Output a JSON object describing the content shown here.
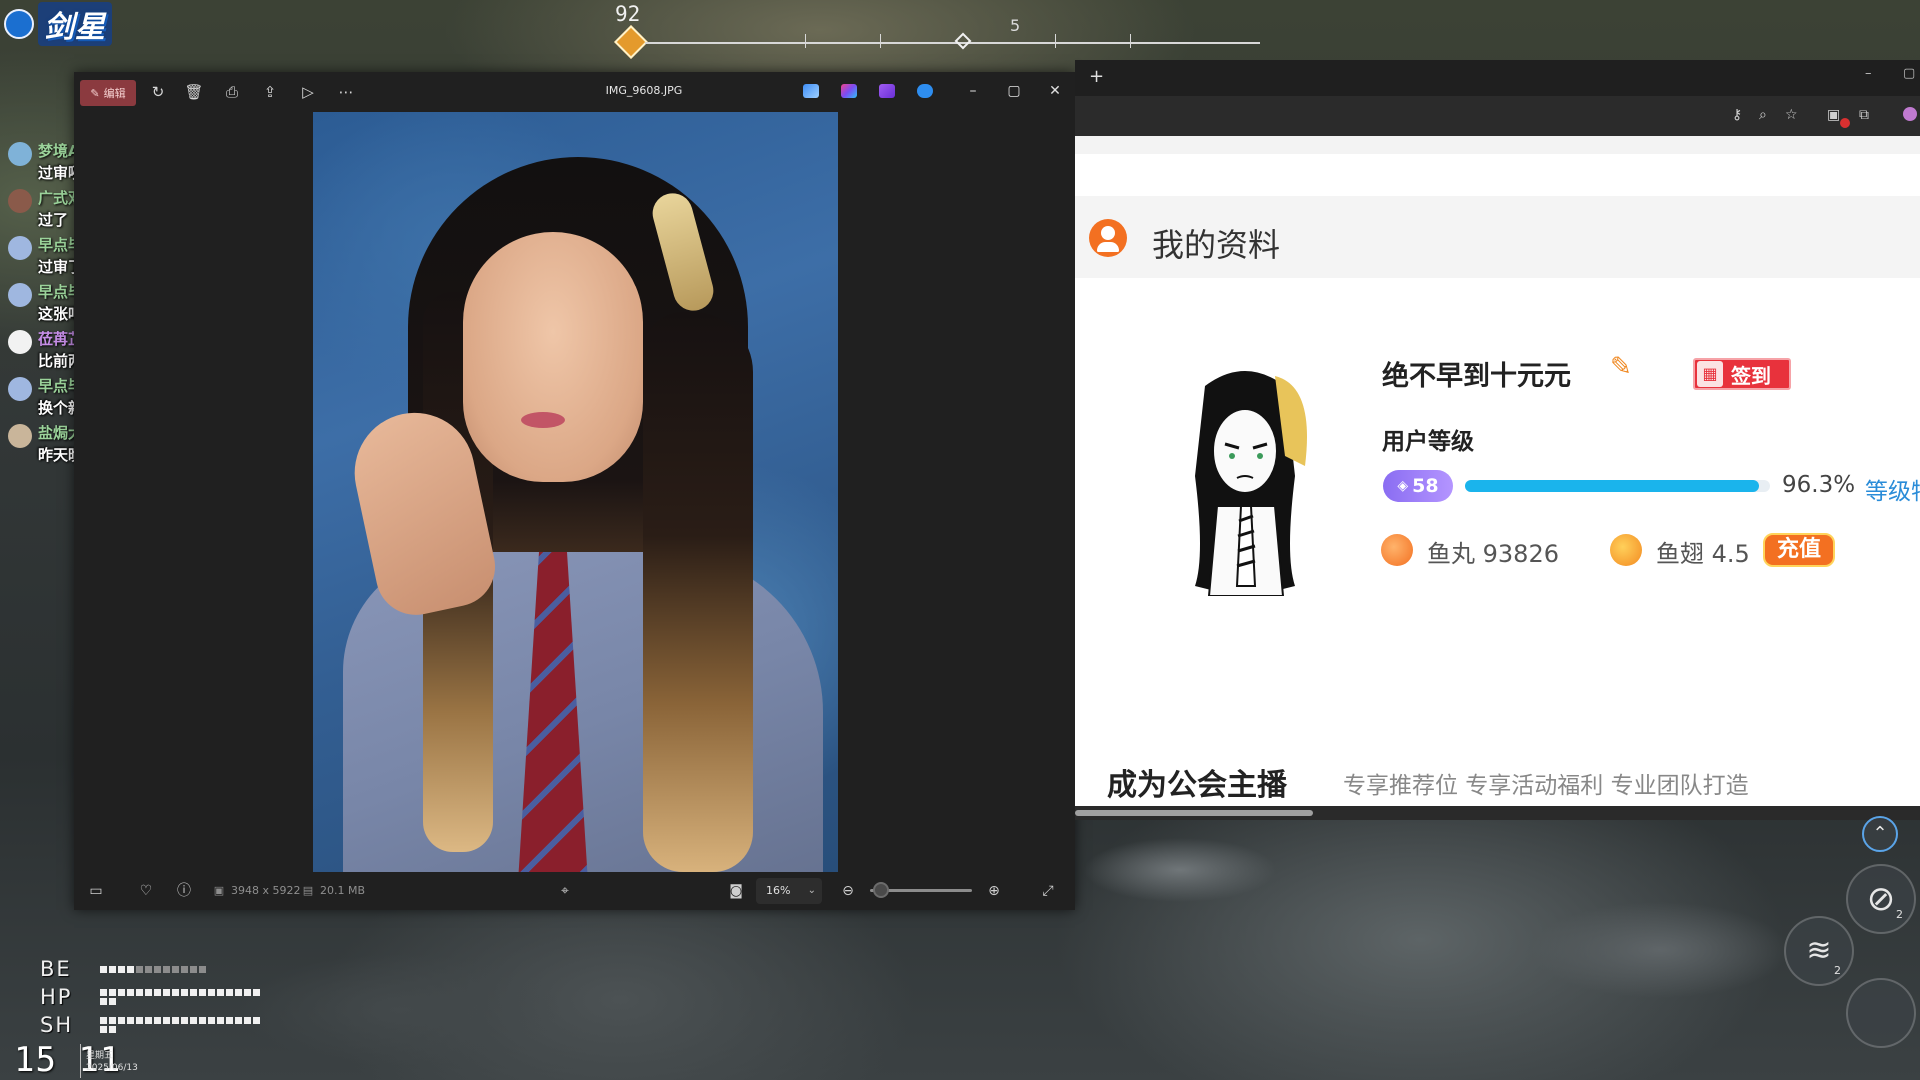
{
  "hud": {
    "logo_text": "剑星",
    "compass_left_number": "92",
    "compass_right_number": "5",
    "stats": [
      {
        "label": "BE",
        "filled": 4,
        "total": 12
      },
      {
        "label": "HP",
        "filled": 40,
        "total": 40
      },
      {
        "label": "SH",
        "filled": 40,
        "total": 40
      }
    ],
    "clock_time": "15 11",
    "clock_day": "星期五",
    "clock_date": "2025/06/13",
    "key_hints": [
      "2",
      "2"
    ]
  },
  "chat": {
    "messages": [
      {
        "user": "梦境Ashe",
        "text": "过审咧",
        "user_color": "#9bd39a",
        "avatar_color": "#7fb2d8"
      },
      {
        "user": "广式双马尾丶",
        "text": "过了",
        "user_color": "#9bd39a",
        "avatar_color": "#8a5a4a"
      },
      {
        "user": "早点毕业的豆豆",
        "text": "过审了",
        "user_color": "#9bd39a",
        "avatar_color": "#9fb7e0"
      },
      {
        "user": "早点毕业的豆豆",
        "text": "这张吧",
        "user_color": "#9bd39a",
        "avatar_color": "#9fb7e0"
      },
      {
        "user": "莅苒芷若",
        "text": "比前两天的COS好",
        "user_color": "#c78ee8",
        "avatar_color": "#f2f2f2"
      },
      {
        "user": "早点毕业的豆豆",
        "text": "换个新风格",
        "user_color": "#9bd39a",
        "avatar_color": "#9fb7e0"
      },
      {
        "user": "盐焗大脑斧",
        "text": "昨天晚上打DLC的BOSS打的头皮发麻",
        "user_color": "#9bd39a",
        "avatar_color": "#c9b59a"
      }
    ]
  },
  "viewer": {
    "edit_label": "编辑",
    "title": "IMG_9608.JPG",
    "dimensions": "3948 x 5922",
    "file_size": "20.1 MB",
    "zoom": "16%",
    "zoom_level": 0.16
  },
  "browser": {
    "section_title": "我的资料",
    "nickname": "绝不早到十元元",
    "signin_label": "签到",
    "level_label": "用户等级",
    "level_value": "58",
    "level_progress_pct": "96.3%",
    "level_progress": 0.963,
    "level_link": "等级特权",
    "yuwan_label": "鱼丸",
    "yuwan_value": "93826",
    "yuchi_label": "鱼翅",
    "yuchi_value": "4.5",
    "recharge_label": "充值",
    "guild_title": "成为公会主播",
    "guild_subtitle": "专享推荐位 专享活动福利 专业团队打造"
  },
  "colors": {
    "accent_orange": "#f37021",
    "level_blue": "#1ab4ec",
    "signin_red": "#e8323c",
    "badge_purple": "#8a6df2"
  }
}
